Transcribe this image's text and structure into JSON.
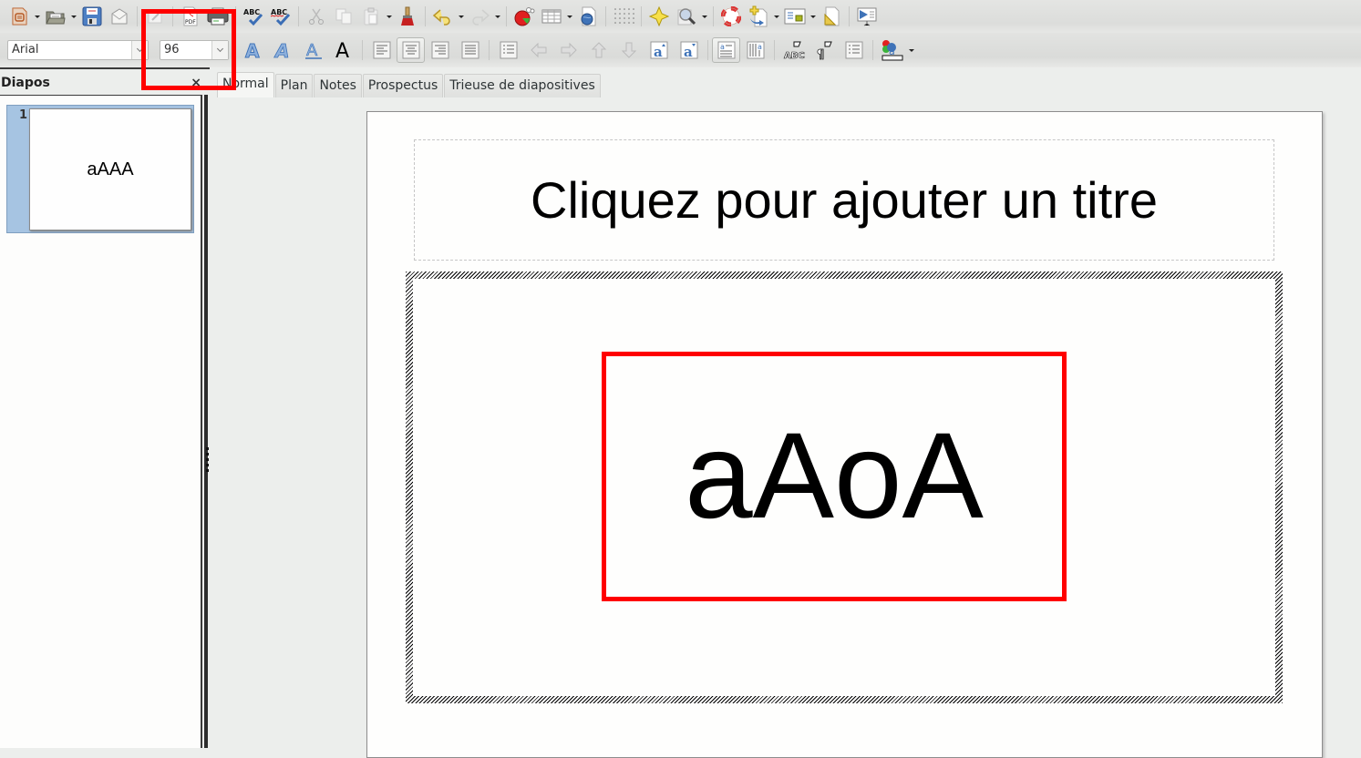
{
  "toolbar_standard": {
    "items": [
      {
        "name": "new-document",
        "tip": "Nouveau"
      },
      {
        "name": "open",
        "tip": "Ouvrir"
      },
      {
        "name": "save",
        "tip": "Enregistrer"
      },
      {
        "name": "email",
        "tip": "Document par e-mail"
      },
      {
        "name": "edit-file",
        "tip": "Éditer le fichier"
      },
      {
        "name": "export-pdf",
        "tip": "Exporter au format PDF",
        "label": "PDF"
      },
      {
        "name": "print",
        "tip": "Imprimer"
      },
      {
        "name": "spellcheck",
        "tip": "Orthographe",
        "label": "ABC"
      },
      {
        "name": "autospellcheck",
        "tip": "Vérification automatique",
        "label": "ABC"
      },
      {
        "name": "cut",
        "tip": "Couper"
      },
      {
        "name": "copy",
        "tip": "Copier"
      },
      {
        "name": "paste",
        "tip": "Coller"
      },
      {
        "name": "clone-formatting",
        "tip": "Cloner le formatage"
      },
      {
        "name": "undo",
        "tip": "Annuler"
      },
      {
        "name": "redo",
        "tip": "Rétablir"
      },
      {
        "name": "chart",
        "tip": "Diagramme"
      },
      {
        "name": "table",
        "tip": "Tableau"
      },
      {
        "name": "hyperlink",
        "tip": "Hyperlien"
      },
      {
        "name": "grid",
        "tip": "Afficher la grille"
      },
      {
        "name": "gallery",
        "tip": "Gallery"
      },
      {
        "name": "zoom",
        "tip": "Zoom"
      },
      {
        "name": "help",
        "tip": "Aide"
      },
      {
        "name": "new-slide",
        "tip": "Diapo"
      },
      {
        "name": "slide-layout",
        "tip": "Mise en page"
      },
      {
        "name": "slide-design",
        "tip": "Conception de diapo"
      },
      {
        "name": "slideshow",
        "tip": "Diaporama"
      }
    ]
  },
  "toolbar_format": {
    "font_name": "Arial",
    "font_size": "96",
    "labels": {
      "bold_a": "A",
      "superscript": "a",
      "subscript": "a",
      "spelling": "ABC",
      "pilcrow": "¶"
    }
  },
  "slides_panel": {
    "title": "Diapos",
    "close_glyph": "×",
    "slides": [
      {
        "number": "1",
        "thumb_text": "aAAA"
      }
    ]
  },
  "view_tabs": [
    {
      "label": "Normal",
      "active": true
    },
    {
      "label": "Plan",
      "active": false
    },
    {
      "label": "Notes",
      "active": false
    },
    {
      "label": "Prospectus",
      "active": false
    },
    {
      "label": "Trieuse de diapositives",
      "active": false
    }
  ],
  "slide": {
    "title_placeholder": "Cliquez pour ajouter un titre",
    "content_text": "aAoA"
  },
  "colors": {
    "annotation_red": "#ff0000",
    "selection_blue": "#a6c4e2"
  }
}
